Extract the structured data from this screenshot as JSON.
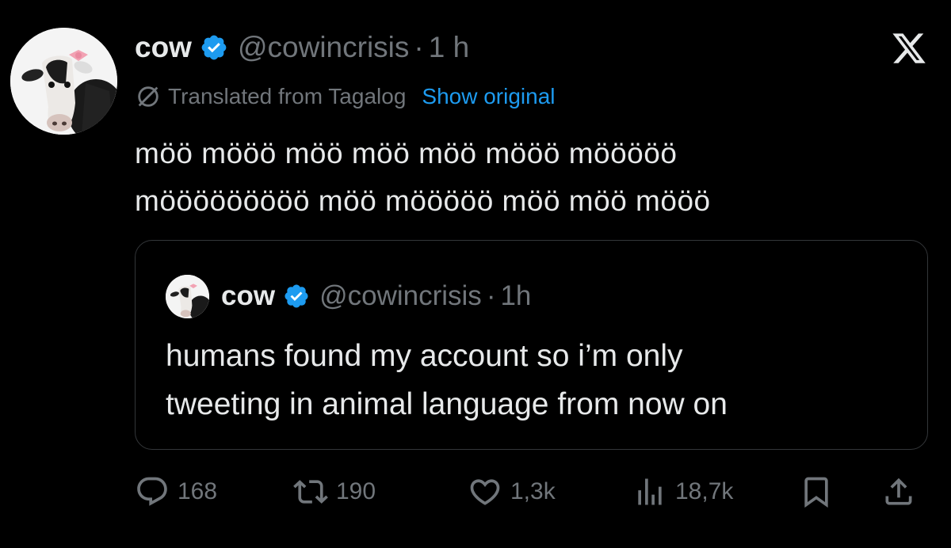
{
  "tweet": {
    "display_name": "cow",
    "handle": "@cowincrisis",
    "separator": "·",
    "time": "1 h",
    "translated_label": "Translated from Tagalog",
    "show_original_label": "Show original",
    "text_lines": [
      "möö mööö möö möö möö mööö mööööö",
      "mööööööööö möö mööööö möö möö mööö"
    ]
  },
  "quoted_tweet": {
    "display_name": "cow",
    "handle": "@cowincrisis",
    "separator": "·",
    "time": "1h",
    "text_lines": [
      "humans found my account so i’m only",
      "tweeting in animal language from now on"
    ]
  },
  "actions": {
    "replies": "168",
    "reposts": "190",
    "likes": "1,3k",
    "views": "18,7k"
  },
  "icons": {
    "verified": "verified-badge-icon",
    "x_logo": "x-logo-icon",
    "translate": "globe-slash-icon",
    "reply": "reply-icon",
    "repost": "repost-icon",
    "like": "heart-icon",
    "views": "views-icon",
    "bookmark": "bookmark-icon",
    "share": "share-icon"
  },
  "colors": {
    "background": "#000000",
    "text": "#e7e9ea",
    "muted": "#71767b",
    "accent": "#1d9bf0",
    "border": "#333639"
  }
}
